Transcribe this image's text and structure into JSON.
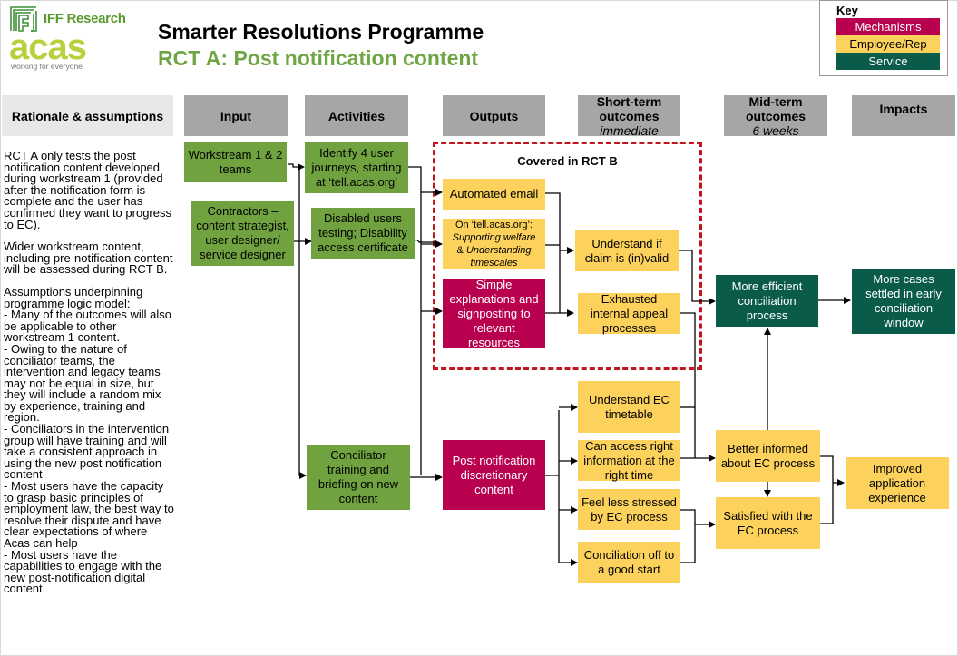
{
  "header": {
    "logos": {
      "iff": "IFF Research",
      "acas": "acas",
      "acas_tagline": "working for everyone"
    },
    "title": "Smarter Resolutions Programme",
    "subtitle": "RCT A: Post notification content"
  },
  "key": {
    "title": "Key",
    "items": [
      {
        "label": "Mechanisms",
        "color": "#b8004e"
      },
      {
        "label": "Employee/Rep",
        "color": "#fcd25c"
      },
      {
        "label": "Service",
        "color": "#0a5b4a"
      }
    ]
  },
  "columns": {
    "rationale": "Rationale & assumptions",
    "input": "Input",
    "activities": "Activities",
    "outputs": "Outputs",
    "short_term": {
      "title": "Short-term outcomes",
      "sub": "immediate"
    },
    "mid_term": {
      "title": "Mid-term outcomes",
      "sub": "6 weeks"
    },
    "impacts": "Impacts"
  },
  "rationale": {
    "paragraphs": [
      "RCT A only tests the post notification content developed during workstream 1 (provided after the notification form is complete and the user has confirmed they want to progress to EC).",
      "Wider workstream content, including pre-notification content will be assessed during RCT B.",
      "Assumptions underpinning programme logic model:\n- Many of the outcomes will also be applicable to other workstream 1 content.\n- Owing to the nature of conciliator teams, the intervention and legacy teams may not be equal in size, but they will include a random mix by experience, training and region.\n- Conciliators in the intervention group will have training and will take a consistent approach in using the new post notification content\n- Most users have the capacity to grasp basic principles of employment law, the best way to resolve their dispute and have clear expectations of where Acas can help\n- Most users have the capabilities to engage with the new post-notification digital content."
    ]
  },
  "covered_label": "Covered in RCT B",
  "nodes": {
    "input_1": "Workstream 1 & 2 teams",
    "input_2": "Contractors – content strategist, user designer/ service designer",
    "activity_1": "Identify 4 user journeys, starting at ‘tell.acas.org’",
    "activity_2": "Disabled users testing; Disability access certificate",
    "activity_3": "Conciliator training and briefing on new content",
    "output_1": "Automated email",
    "output_2_a": "On ‘tell.acas.org’:",
    "output_2_b": "Supporting welfare",
    "output_2_c": "& ",
    "output_2_d": "Understanding",
    "output_2_e": "timescales",
    "output_3": "Simple explanations and signposting to relevant resources",
    "output_4": "Post notification discretionary content",
    "short_1": "Understand if claim is (in)valid",
    "short_2": "Exhausted internal appeal processes",
    "short_3": "Understand EC timetable",
    "short_4": "Can access right information at the right time",
    "short_5": "Feel less stressed by EC process",
    "short_6": "Conciliation off to a good start",
    "mid_1": "More efficient conciliation process",
    "mid_2": "Better informed about EC process",
    "mid_3": "Satisfied with the EC process",
    "impact_1": "More cases settled in early conciliation window",
    "impact_2": "Improved application experience"
  }
}
